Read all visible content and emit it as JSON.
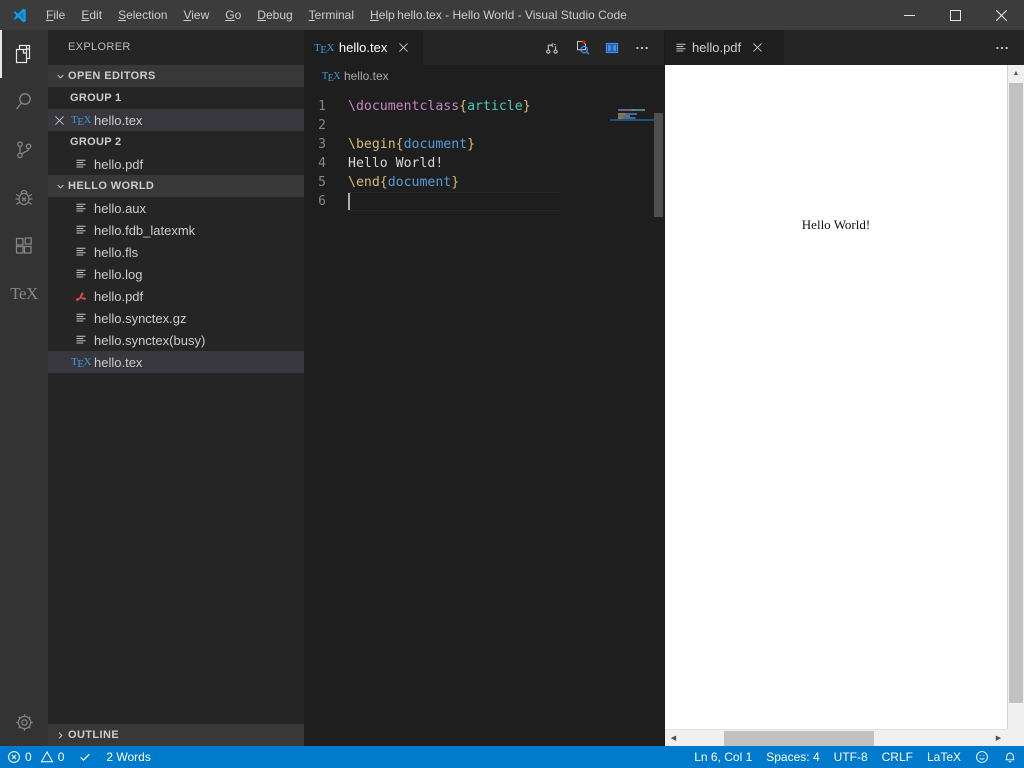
{
  "window": {
    "title": "hello.tex - Hello World - Visual Studio Code",
    "minimize_label": "Minimize",
    "maximize_label": "Maximize",
    "close_label": "Close"
  },
  "menubar": {
    "items": [
      {
        "label": "File",
        "mnemonic": "F",
        "rest": "ile"
      },
      {
        "label": "Edit",
        "mnemonic": "E",
        "rest": "dit"
      },
      {
        "label": "Selection",
        "mnemonic": "S",
        "rest": "election"
      },
      {
        "label": "View",
        "mnemonic": "V",
        "rest": "iew"
      },
      {
        "label": "Go",
        "mnemonic": "G",
        "rest": "o"
      },
      {
        "label": "Debug",
        "mnemonic": "D",
        "rest": "ebug"
      },
      {
        "label": "Terminal",
        "mnemonic": "T",
        "rest": "erminal"
      },
      {
        "label": "Help",
        "mnemonic": "H",
        "rest": "elp"
      }
    ]
  },
  "activitybar": {
    "items": [
      {
        "name": "explorer",
        "icon": "files-icon",
        "active": true
      },
      {
        "name": "search",
        "icon": "search-icon",
        "active": false
      },
      {
        "name": "source-control",
        "icon": "source-control-icon",
        "active": false
      },
      {
        "name": "debug",
        "icon": "debug-icon",
        "active": false
      },
      {
        "name": "extensions",
        "icon": "extensions-icon",
        "active": false
      },
      {
        "name": "latex-workshop",
        "icon": "tex-icon",
        "active": false,
        "label": "TeX"
      }
    ],
    "manage": {
      "name": "manage",
      "icon": "gear-icon"
    }
  },
  "sidebar": {
    "title": "EXPLORER",
    "open_editors": {
      "label": "OPEN EDITORS",
      "expanded": true,
      "groups": [
        {
          "label": "GROUP 1",
          "items": [
            {
              "name": "hello.tex",
              "icon": "tex-file-icon",
              "selected": true,
              "has_close": true
            }
          ]
        },
        {
          "label": "GROUP 2",
          "items": [
            {
              "name": "hello.pdf",
              "icon": "file-lines-icon",
              "selected": false,
              "has_close": false
            }
          ]
        }
      ]
    },
    "folder": {
      "label": "HELLO WORLD",
      "expanded": true,
      "files": [
        {
          "name": "hello.aux",
          "icon": "file-lines-icon",
          "selected": false
        },
        {
          "name": "hello.fdb_latexmk",
          "icon": "file-lines-icon",
          "selected": false
        },
        {
          "name": "hello.fls",
          "icon": "file-lines-icon",
          "selected": false
        },
        {
          "name": "hello.log",
          "icon": "file-lines-icon",
          "selected": false
        },
        {
          "name": "hello.pdf",
          "icon": "pdf-file-icon",
          "selected": false
        },
        {
          "name": "hello.synctex.gz",
          "icon": "file-lines-icon",
          "selected": false
        },
        {
          "name": "hello.synctex(busy)",
          "icon": "file-lines-icon",
          "selected": false
        },
        {
          "name": "hello.tex",
          "icon": "tex-file-icon",
          "selected": true
        }
      ]
    },
    "outline": {
      "label": "OUTLINE",
      "expanded": false
    }
  },
  "editor_group_1": {
    "tab": {
      "label": "hello.tex",
      "icon": "tex-file-icon",
      "active": true,
      "close_icon": "close-icon"
    },
    "actions": [
      {
        "name": "build-latex-project",
        "icon": "build-icon"
      },
      {
        "name": "view-latex-log",
        "icon": "log-search-icon"
      },
      {
        "name": "split-editor",
        "icon": "split-editor-icon"
      },
      {
        "name": "more-actions",
        "icon": "ellipsis-icon"
      }
    ],
    "breadcrumb": {
      "icon": "tex-file-icon",
      "label": "hello.tex"
    },
    "code": {
      "lines": [
        {
          "no": "1",
          "tokens": [
            {
              "t": "\\documentclass",
              "c": "cmd-pink"
            },
            {
              "t": "{",
              "c": "brace"
            },
            {
              "t": "article",
              "c": "cls"
            },
            {
              "t": "}",
              "c": "brace"
            }
          ]
        },
        {
          "no": "2",
          "tokens": []
        },
        {
          "no": "3",
          "tokens": [
            {
              "t": "\\begin",
              "c": "cmd-gold"
            },
            {
              "t": "{",
              "c": "brace"
            },
            {
              "t": "document",
              "c": "env"
            },
            {
              "t": "}",
              "c": "brace"
            }
          ]
        },
        {
          "no": "4",
          "tokens": [
            {
              "t": "Hello World!",
              "c": "plain"
            }
          ]
        },
        {
          "no": "5",
          "tokens": [
            {
              "t": "\\end",
              "c": "cmd-gold"
            },
            {
              "t": "{",
              "c": "brace"
            },
            {
              "t": "document",
              "c": "env"
            },
            {
              "t": "}",
              "c": "brace"
            }
          ]
        },
        {
          "no": "6",
          "tokens": [],
          "cursor": true
        }
      ]
    }
  },
  "editor_group_2": {
    "tab": {
      "label": "hello.pdf",
      "icon": "file-lines-icon",
      "active": true,
      "close_icon": "close-icon"
    },
    "actions": [
      {
        "name": "more-actions",
        "icon": "ellipsis-icon"
      }
    ],
    "preview": {
      "text": "Hello World!"
    }
  },
  "statusbar": {
    "left": [
      {
        "name": "problems",
        "icon": "error-icon",
        "errors": "0",
        "warn_icon": "warning-icon",
        "warnings": "0"
      },
      {
        "name": "latex-build-status",
        "icon": "check-icon",
        "label": ""
      },
      {
        "name": "word-count",
        "label": "2 Words"
      }
    ],
    "right": [
      {
        "name": "editor-position",
        "label": "Ln 6, Col 1"
      },
      {
        "name": "editor-indentation",
        "label": "Spaces: 4"
      },
      {
        "name": "editor-encoding",
        "label": "UTF-8"
      },
      {
        "name": "editor-eol",
        "label": "CRLF"
      },
      {
        "name": "editor-language",
        "label": "LaTeX"
      },
      {
        "name": "feedback",
        "icon": "smiley-icon",
        "label": ""
      },
      {
        "name": "notifications",
        "icon": "bell-icon",
        "label": ""
      }
    ]
  },
  "colors": {
    "accent": "#007acc",
    "titlebar": "#3c3c3c",
    "activitybar": "#333333",
    "sidebar": "#252526",
    "editor": "#1e1e1e",
    "tab_inactive": "#2d2d2d",
    "cmd_pink": "#c586c0",
    "brace_gold": "#d7ba7d",
    "class_teal": "#4ec9b0",
    "env_blue": "#569cd6",
    "text_plain": "#d4d4d4"
  }
}
